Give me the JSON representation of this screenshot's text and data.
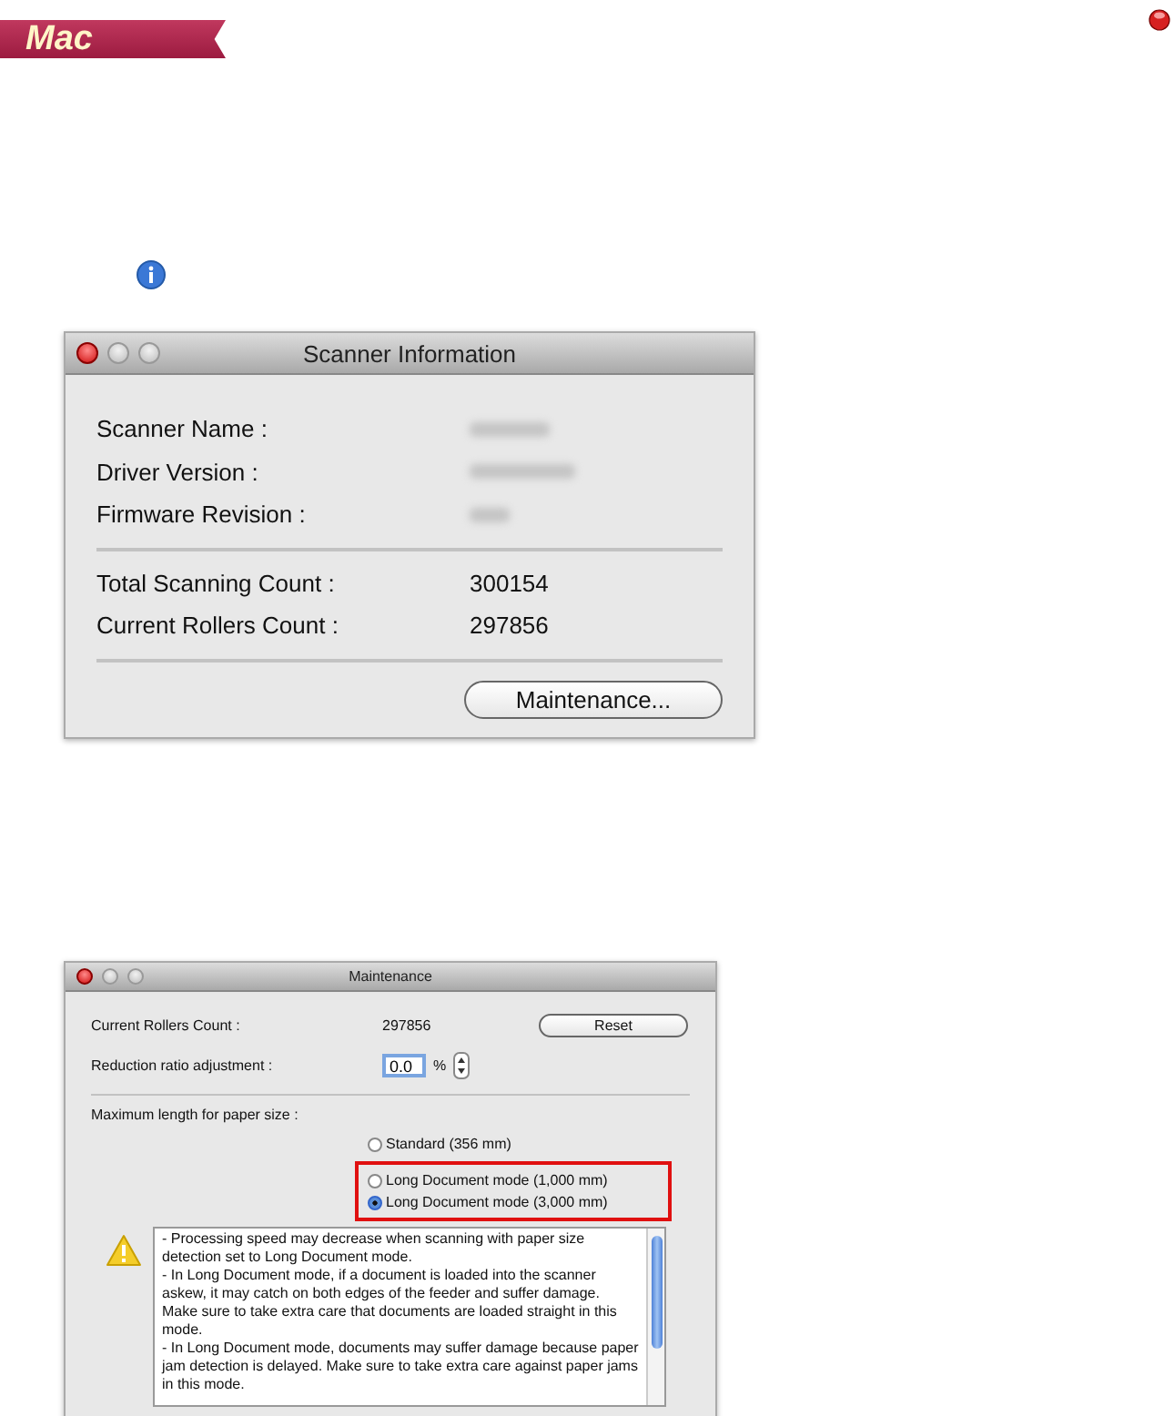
{
  "banner": {
    "label": "Mac"
  },
  "info_window": {
    "title": "Scanner Information",
    "rows": [
      {
        "label": "Scanner Name :",
        "blurred": true
      },
      {
        "label": "Driver Version :",
        "blurred": true
      },
      {
        "label": "Firmware Revision :",
        "blurred": true
      }
    ],
    "counts": [
      {
        "label": "Total Scanning Count :",
        "value": "300154"
      },
      {
        "label": "Current Rollers Count :",
        "value": "297856"
      }
    ],
    "button": "Maintenance..."
  },
  "maintenance_window": {
    "title": "Maintenance",
    "rollers": {
      "label": "Current Rollers Count :",
      "value": "297856",
      "button": "Reset"
    },
    "reduction": {
      "label": "Reduction ratio adjustment :",
      "value": "0.0",
      "unit": "%"
    },
    "paper_size": {
      "label": "Maximum length for paper size :",
      "options": [
        {
          "label": "Standard (356 mm)",
          "selected": false,
          "highlighted": false
        },
        {
          "label": "Long Document mode (1,000 mm)",
          "selected": false,
          "highlighted": true
        },
        {
          "label": "Long Document mode (3,000 mm)",
          "selected": true,
          "highlighted": true
        }
      ]
    },
    "warning_lines": [
      "- Processing speed may decrease when scanning with paper size detection set to Long Document mode.",
      "- In Long Document mode, if a document is loaded into the scanner askew, it may catch on both edges of the feeder and suffer damage. Make sure to take extra care that documents are loaded straight in this mode.",
      "- In Long Document mode, documents may suffer damage because paper jam detection is delayed. Make sure to take extra care against paper jams in this mode."
    ]
  }
}
